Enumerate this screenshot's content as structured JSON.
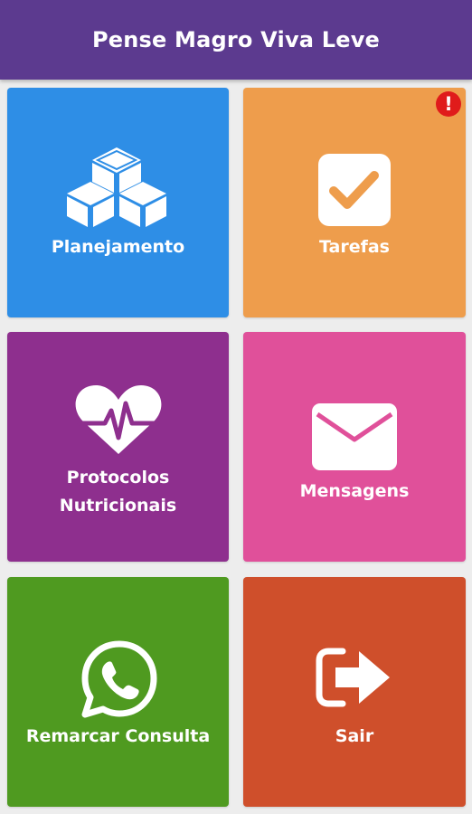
{
  "app_bar": {
    "title": "Pense Magro Viva Leve",
    "color": "#5c3a8f"
  },
  "tiles": [
    {
      "label": "Planejamento",
      "icon": "cubes-icon",
      "color": "#2e8ee6"
    },
    {
      "label": "Tarefas",
      "icon": "checkbox-icon",
      "color": "#ee9d4c",
      "badge": "!",
      "badge_color": "#e01b1b"
    },
    {
      "label": "Protocolos\nNutricionais",
      "icon": "heartbeat-icon",
      "color": "#8e2f8e"
    },
    {
      "label": "Mensagens",
      "icon": "envelope-icon",
      "color": "#e0509a"
    },
    {
      "label": "Remarcar Consulta",
      "icon": "whatsapp-icon",
      "color": "#4f9a20"
    },
    {
      "label": "Sair",
      "icon": "sign-out-icon",
      "color": "#cf4f2b"
    }
  ]
}
